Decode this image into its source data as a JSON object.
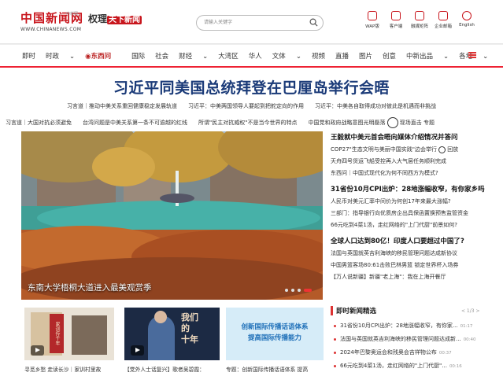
{
  "logo": {
    "title": "中国新闻网",
    "domain": "WWW.CHINANEWS.COM",
    "tag": "中新网"
  },
  "slogan": {
    "text": "权理",
    "highlight": "天下新闻"
  },
  "search": {
    "placeholder": "请输入关键字"
  },
  "tools": [
    {
      "label": "WAP版",
      "icon": "mobile-icon"
    },
    {
      "label": "客户端",
      "icon": "app-icon"
    },
    {
      "label": "融媒矩阵",
      "icon": "grid-icon"
    },
    {
      "label": "企业邮箱",
      "icon": "mail-icon"
    },
    {
      "label": "English",
      "icon": "english-icon"
    }
  ],
  "nav": [
    "即时",
    "时政",
    "东西问",
    "国际",
    "社会",
    "财经",
    "大湾区",
    "华人",
    "文体",
    "视频",
    "直播",
    "图片",
    "创意",
    "中新出品",
    "各地"
  ],
  "headline": "习近平同美国总统拜登在巴厘岛举行会晤",
  "sublinks": [
    "习言道｜推动中美关系重回健康稳定发展轨道　　习近平：中美两国领导人要起到把舵定向的作用　　习近平：中美各自取得成功对彼此是机遇而非挑战",
    "习言道｜大国对抗必须避免　　台湾问题是中美关系第一条不可逾越的红线　　所谓\"民主对抗威权\"不是当今世界的特点　　中国党和政府战略意图光明磊落",
    "现场直击",
    "专题"
  ],
  "hero": {
    "caption": "东南大学梧桐大道进入最美观赏季",
    "colors": {
      "accent": "#e33333",
      "sky": "#9fb8c8"
    }
  },
  "right": {
    "items": [
      {
        "text": "王毅就中美元首会晤向媒体介绍情况并答问",
        "bold": true
      },
      {
        "text": "COP27\"生态文明与美丽中国实践\"边会举行",
        "extra": "回放"
      },
      {
        "text": "天舟四号货运飞船受控再入大气层任务顺利完成"
      },
      {
        "text": "东西问｜中国式现代化为何不同西方为模式?"
      },
      {
        "text": "31省份10月CPI出炉：28地涨幅收窄，有你家乡吗",
        "bold": true
      },
      {
        "text": "人民币对美元汇率中间价为何创17年来最大涨幅?"
      },
      {
        "text": "三部门：指导银行向优质房企出具保函置换预售监管资金"
      },
      {
        "text": "66元吃到4菜1汤，走红网络的\"上门代厨\"前景如何?"
      },
      {
        "text": "全球人口达到80亿！印度人口要超过中国了?",
        "bold": true
      },
      {
        "text": "法国与英国就英吉利海峡的移民管理问题达成新协议"
      },
      {
        "text": "中国男篮客场80:61击败巴林男篮 锁定世界杯入场券"
      },
      {
        "text": "【万人说新疆】新疆\"老上海\"：我在上海开餐厅"
      }
    ]
  },
  "timely": {
    "title": "即时新闻精选",
    "pager": "< 1/3 >",
    "items": [
      {
        "text": "31省份10月CPI出炉：28地涨幅收窄，有你家...",
        "time": "01:17"
      },
      {
        "text": "法国与英国就英吉利海峡的移民管理问题达成新...",
        "time": "00:40"
      },
      {
        "text": "2024年巴黎奥运会和残奥会吉祥物公布",
        "time": "00:37"
      },
      {
        "text": "66元吃到4菜1汤，走红网络的\"上门代厨\"...",
        "time": "00:16"
      }
    ]
  },
  "thumbs": [
    {
      "caption": "寻觅乡愁 走读长沙｜家训村里故"
    },
    {
      "caption": "【党外人士话复兴】歌者吴碧霞："
    },
    {
      "caption": "专题：创新国际传播话语体系 提高"
    }
  ],
  "banner": {
    "line1": "创新国际传播话语体系",
    "line2": "提高国际传播能力"
  },
  "poster": {
    "line1": "我们",
    "line2": "的",
    "line3": "十年"
  },
  "book": {
    "title": "家训传千年"
  }
}
